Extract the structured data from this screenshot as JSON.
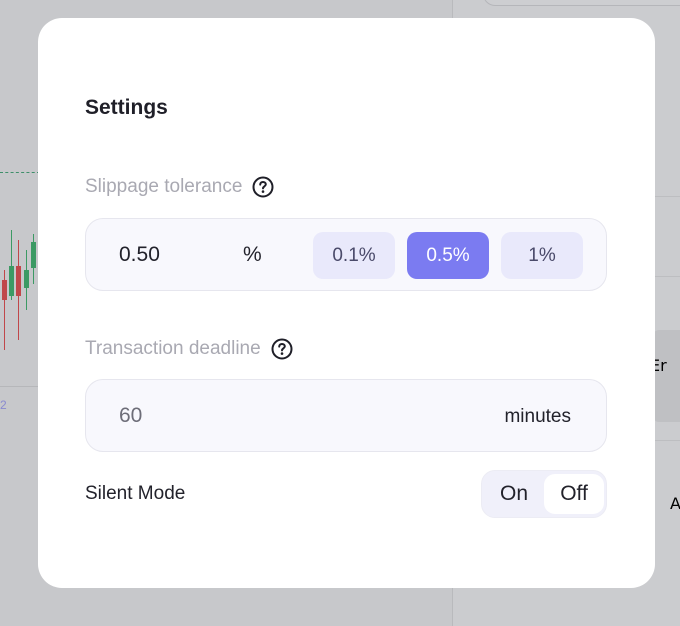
{
  "settings": {
    "title": "Settings",
    "slippage": {
      "label": "Slippage tolerance",
      "help_icon": "question-circle-icon",
      "value": "0.50",
      "unit": "%",
      "presets": [
        {
          "label": "0.1%",
          "selected": false
        },
        {
          "label": "0.5%",
          "selected": true
        },
        {
          "label": "1%",
          "selected": false
        }
      ]
    },
    "deadline": {
      "label": "Transaction deadline",
      "help_icon": "question-circle-icon",
      "value": "60",
      "unit": "minutes"
    },
    "silent_mode": {
      "label": "Silent Mode",
      "on_label": "On",
      "off_label": "Off",
      "selected": "Off"
    }
  },
  "background": {
    "button_text": "Er",
    "link_text": "A",
    "axis_tick": "2"
  },
  "colors": {
    "accent": "#7b7bf1",
    "chip_bg": "#e9e9fb",
    "overlay": "#c7c8cb"
  }
}
